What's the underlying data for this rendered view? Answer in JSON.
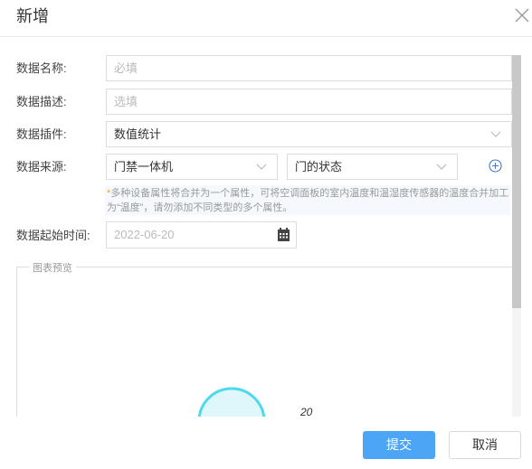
{
  "dialog": {
    "title": "新增"
  },
  "form": {
    "name_label": "数据名称:",
    "name_placeholder": "必填",
    "desc_label": "数据描述:",
    "desc_placeholder": "选填",
    "plugin_label": "数据插件:",
    "plugin_value": "数值统计",
    "source_label": "数据来源:",
    "source_device": "门禁一体机",
    "source_attr": "门的状态",
    "hint_star": "*",
    "hint_text": "多种设备属性将合并为一个属性，可将空调面板的室内温度和温湿度传感器的温度合并加工为“温度”，请勿添加不同类型的多个属性。",
    "start_label": "数据起始时间:",
    "start_value": "2022-06-20"
  },
  "preview": {
    "legend": "图表预览",
    "gauge_label": "20",
    "ring_color": "#4dd9ee",
    "fill_color": "#dff7fb"
  },
  "footer": {
    "submit_label": "提交",
    "cancel_label": "取消"
  }
}
